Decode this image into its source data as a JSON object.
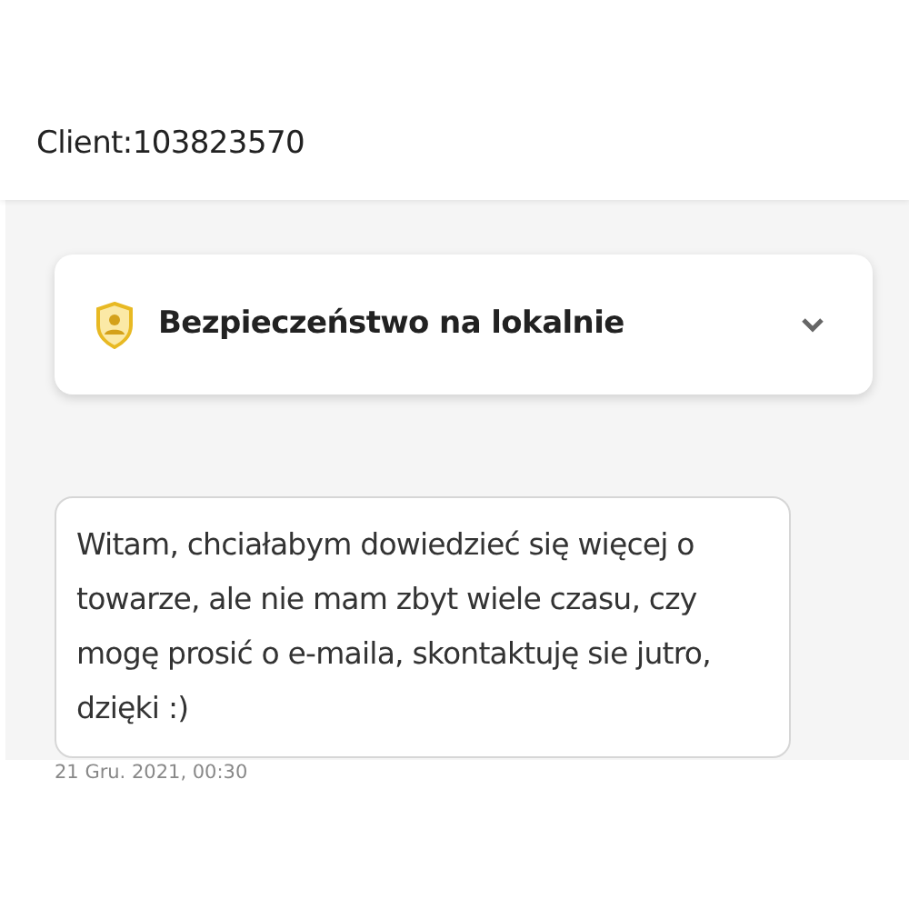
{
  "header": {
    "title": "Client:103823570"
  },
  "accordion": {
    "title": "Bezpieczeństwo na lokalnie",
    "expanded": false
  },
  "messages": [
    {
      "text": "Witam, chciałabym dowiedzieć się więcej o towarze, ale nie mam zbyt wiele czasu, czy mogę prosić o e-maila, skontaktuję sie jutro, dzięki :)",
      "time": "21 Gru. 2021, 00:30"
    }
  ]
}
